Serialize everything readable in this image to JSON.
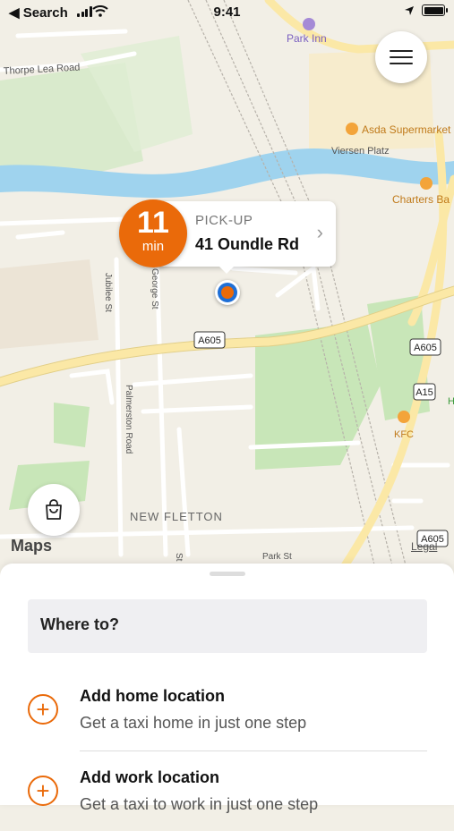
{
  "status_bar": {
    "back_label": "◀ Search",
    "time": "9:41"
  },
  "map": {
    "labels": {
      "thorpe_lea_road": "Thorpe Lea Road",
      "park_inn": "Park Inn",
      "asda": "Asda Supermarket",
      "viersen_platz": "Viersen Platz",
      "charters": "Charters Ba",
      "jubilee_st": "Jubilee St",
      "george_st": "George St",
      "palmerston_road": "Palmerston Road",
      "a605_main": "A605",
      "a605_right": "A605",
      "a15": "A15",
      "kfc": "KFC",
      "h": "H",
      "new_fletton": "NEW FLETTON",
      "park_st": "Park St",
      "a605_bottom": "A605",
      "st": "St"
    },
    "brand": "Maps",
    "legal": "Legal"
  },
  "eta": {
    "value": "11",
    "unit": "min"
  },
  "pickup": {
    "label": "PICK-UP",
    "address": "41 Oundle Rd"
  },
  "sheet": {
    "search_label": "Where to?",
    "items": [
      {
        "title": "Add home location",
        "subtitle": "Get a taxi home in just one step"
      },
      {
        "title": "Add work location",
        "subtitle": "Get a taxi to work in just one step"
      }
    ]
  },
  "colors": {
    "accent": "#ea6a0a",
    "river": "#9fd3ee",
    "park": "#cfe8c0",
    "road": "#fbe8a6"
  }
}
